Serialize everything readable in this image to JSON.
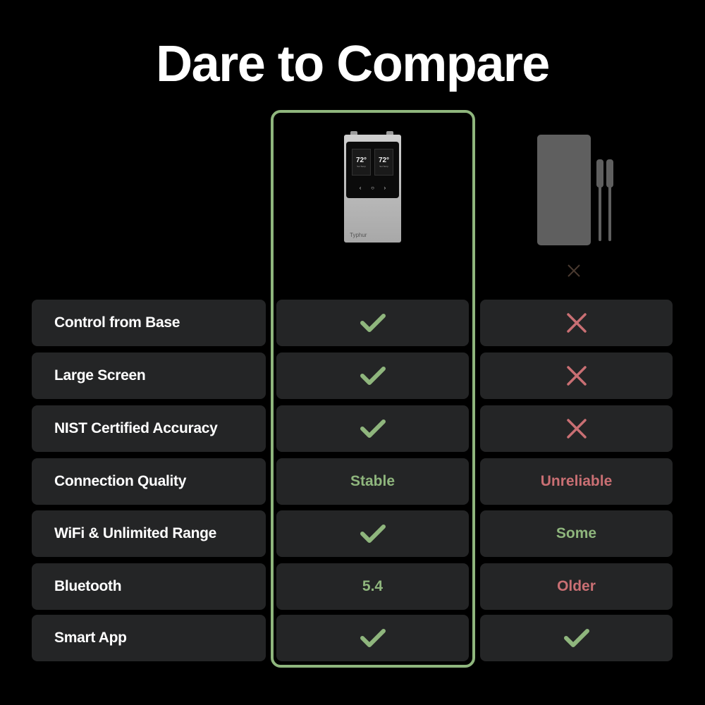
{
  "title": "Dare to Compare",
  "colors": {
    "accent_green": "#8fb67d",
    "negative_red": "#c96f73",
    "cell_background": "#242526",
    "page_background": "#000000"
  },
  "products": {
    "ours": {
      "image": "Typhur wireless thermometer base with screen",
      "brand_on_device": "Typhur",
      "screen_temps": [
        "72°",
        "72°"
      ],
      "screen_caption": "Set Temp",
      "highlighted": true
    },
    "theirs": {
      "image": "generic competitor thermometer base with two probes",
      "marker_icon": "cross-icon"
    }
  },
  "rows": [
    {
      "feature": "Control from Base",
      "ours": {
        "type": "icon",
        "icon": "check-icon"
      },
      "theirs": {
        "type": "icon",
        "icon": "cross-icon"
      }
    },
    {
      "feature": "Large Screen",
      "ours": {
        "type": "icon",
        "icon": "check-icon"
      },
      "theirs": {
        "type": "icon",
        "icon": "cross-icon"
      }
    },
    {
      "feature": "NIST Certified Accuracy",
      "ours": {
        "type": "icon",
        "icon": "check-icon"
      },
      "theirs": {
        "type": "icon",
        "icon": "cross-icon"
      }
    },
    {
      "feature": "Connection Quality",
      "ours": {
        "type": "text",
        "text": "Stable",
        "tone": "good"
      },
      "theirs": {
        "type": "text",
        "text": "Unreliable",
        "tone": "bad"
      }
    },
    {
      "feature": "WiFi & Unlimited Range",
      "ours": {
        "type": "icon",
        "icon": "check-icon"
      },
      "theirs": {
        "type": "text",
        "text": "Some",
        "tone": "good"
      }
    },
    {
      "feature": "Bluetooth",
      "ours": {
        "type": "text",
        "text": "5.4",
        "tone": "good"
      },
      "theirs": {
        "type": "text",
        "text": "Older",
        "tone": "bad"
      }
    },
    {
      "feature": "Smart App",
      "ours": {
        "type": "icon",
        "icon": "check-icon"
      },
      "theirs": {
        "type": "icon",
        "icon": "check-icon"
      }
    }
  ]
}
